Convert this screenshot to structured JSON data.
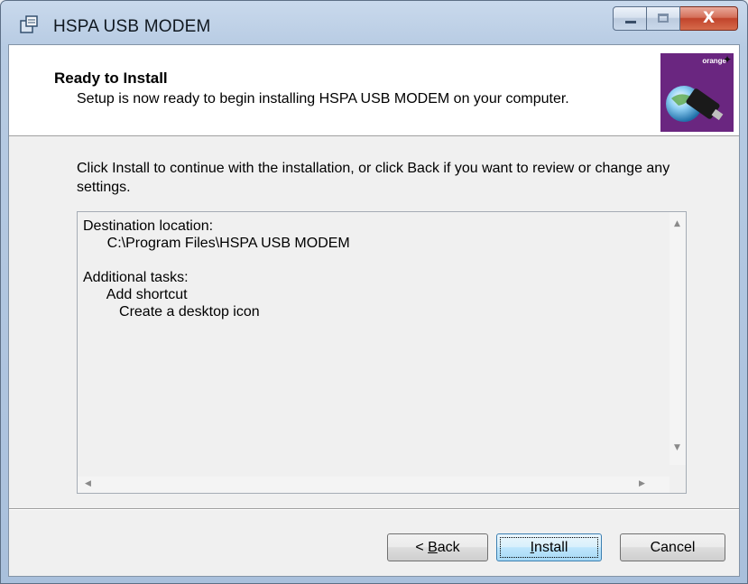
{
  "window": {
    "title": "HSPA USB MODEM",
    "close_glyph": "X"
  },
  "header": {
    "heading": "Ready to Install",
    "subheading": "Setup is now ready to begin installing HSPA USB MODEM on your computer.",
    "logo_brand": "orange"
  },
  "main": {
    "intro": "Click Install to continue with the installation, or click Back if you want to review or change any settings.",
    "memo_lines": [
      "Destination location:",
      "      C:\\Program Files\\HSPA USB MODEM",
      "",
      "Additional tasks:",
      "      Add shortcut",
      "         Create a desktop icon"
    ]
  },
  "buttons": {
    "back_prefix": "< ",
    "back_accel": "B",
    "back_rest": "ack",
    "install_accel": "I",
    "install_rest": "nstall",
    "cancel": "Cancel"
  },
  "colors": {
    "logo_bg": "#6a2680",
    "close_button": "#c1442b",
    "default_button": "#3c7fb1"
  },
  "icons": [
    "installer-app-icon",
    "minimize-icon",
    "maximize-icon",
    "close-icon",
    "modem-globe-icon",
    "scroll-up-arrow-icon",
    "scroll-down-arrow-icon",
    "scroll-left-arrow-icon",
    "scroll-right-arrow-icon"
  ]
}
